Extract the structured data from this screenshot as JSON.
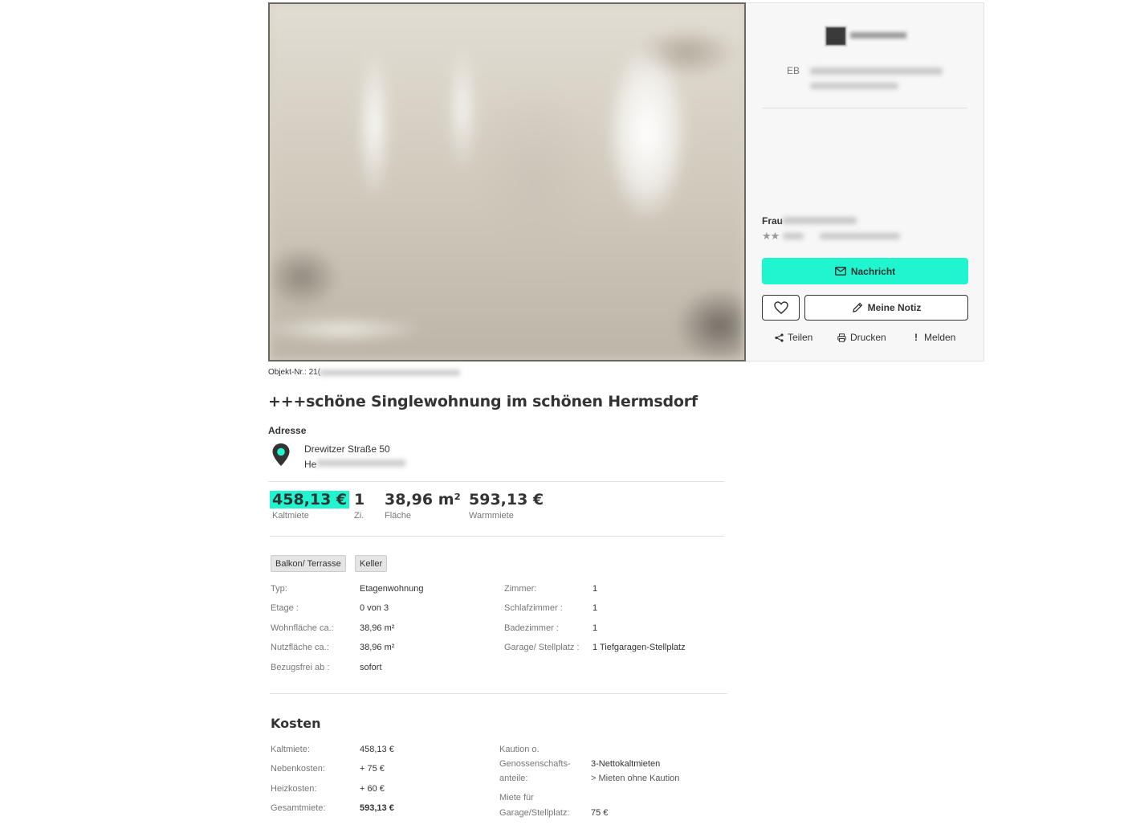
{
  "contact": {
    "agency_prefix": "EB",
    "salutation": "Frau",
    "rating_stars": "★★",
    "message_button": "Nachricht",
    "note_button": "Meine Notiz",
    "actions": {
      "share": "Teilen",
      "print": "Drucken",
      "report": "Melden",
      "report_glyph": "!"
    }
  },
  "listing": {
    "object_no_label": "Objekt-Nr.: 21(",
    "title": "+++schöne Singlewohnung im schönen Hermsdorf",
    "address_label": "Adresse",
    "street": "Drewitzer Straße 50",
    "city_prefix": "He"
  },
  "key_values": [
    {
      "value": "458,13 €",
      "label": "Kaltmiete"
    },
    {
      "value": "1",
      "label": "Zi."
    },
    {
      "value": "38,96 m²",
      "label": "Fläche"
    },
    {
      "value": "593,13 €",
      "label": "Warmmiete"
    }
  ],
  "tags": [
    "Balkon/ Terrasse",
    "Keller"
  ],
  "attributes_left": [
    {
      "label": "Typ:",
      "value": "Etagenwohnung"
    },
    {
      "label": "Etage :",
      "value": "0 von 3"
    },
    {
      "label": "Wohnfläche ca.:",
      "value": "38,96 m²"
    },
    {
      "label": "Nutzfläche ca.:",
      "value": "38,96 m²"
    },
    {
      "label": "Bezugsfrei ab :",
      "value": "sofort"
    }
  ],
  "attributes_right": [
    {
      "label": "Zimmer:",
      "value": "1"
    },
    {
      "label": "Schlafzimmer :",
      "value": "1"
    },
    {
      "label": "Badezimmer :",
      "value": "1"
    },
    {
      "label": "Garage/ Stellplatz :",
      "value": "1 Tiefgaragen-Stellplatz"
    }
  ],
  "kosten": {
    "title": "Kosten",
    "left": [
      {
        "label": "Kaltmiete:",
        "value": "458,13 €"
      },
      {
        "label": "Nebenkosten:",
        "value": "+ 75 €"
      },
      {
        "label": "Heizkosten:",
        "value": "+ 60 €"
      },
      {
        "label": "Gesamtmiete:",
        "value": "593,13 €"
      }
    ],
    "kaution_label_1": "Kaution o.",
    "kaution_label_2": "Genossenschafts-",
    "kaution_label_3": "anteile:",
    "kaution_value": "3-Nettokaltmieten",
    "kaution_link": "> Mieten ohne Kaution",
    "garage_label_1": "Miete für",
    "garage_label_2": "Garage/Stellplatz:",
    "garage_value": "75 €"
  },
  "colors": {
    "accent": "#1ff5cf",
    "text": "#333333",
    "muted": "#777777"
  },
  "icons": [
    "envelope-icon",
    "heart-icon",
    "pencil-icon",
    "share-icon",
    "print-icon",
    "report-icon",
    "map-pin-icon"
  ]
}
